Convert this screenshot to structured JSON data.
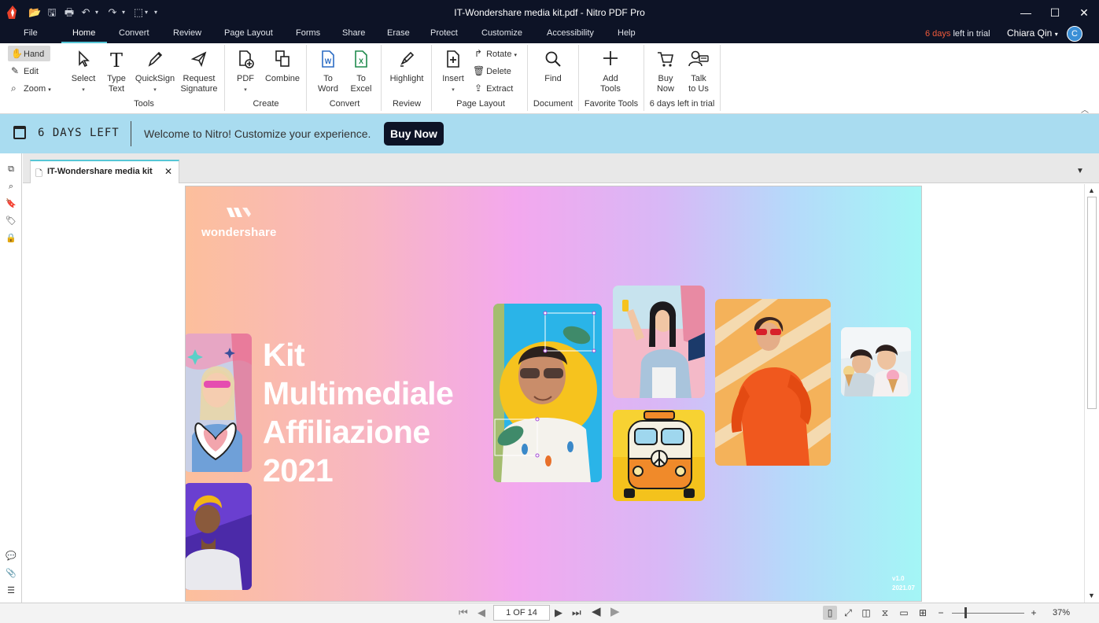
{
  "window": {
    "title": "IT-Wondershare media kit.pdf - Nitro PDF Pro",
    "min_glyph": "—",
    "max_glyph": "☐",
    "close_glyph": "✕"
  },
  "menu": {
    "tabs": [
      "File",
      "Home",
      "Convert",
      "Review",
      "Page Layout",
      "Forms",
      "Share",
      "Erase",
      "Protect",
      "Customize",
      "Accessibility",
      "Help"
    ],
    "active": "Home",
    "trial_days": "6 days",
    "trial_rest": " left in trial",
    "user_name": "Chiara Qin",
    "user_initial": "C"
  },
  "ribbon": {
    "nav_tools": [
      {
        "label": "Hand",
        "icon": "hand-icon"
      },
      {
        "label": "Edit",
        "icon": "edit-icon"
      },
      {
        "label": "Zoom",
        "icon": "zoom-icon"
      }
    ],
    "tools": {
      "select": [
        "Select",
        ""
      ],
      "type_text": [
        "Type",
        "Text"
      ],
      "quicksign": [
        "QuickSign",
        ""
      ],
      "request_signature": [
        "Request",
        "Signature"
      ],
      "group_label": "Tools"
    },
    "create": {
      "pdf": [
        "PDF",
        ""
      ],
      "combine": [
        "Combine",
        ""
      ],
      "group_label": "Create"
    },
    "convert": {
      "to_word": [
        "To",
        "Word"
      ],
      "to_excel": [
        "To",
        "Excel"
      ],
      "group_label": "Convert"
    },
    "review": {
      "highlight": [
        "Highlight",
        ""
      ],
      "group_label": "Review"
    },
    "page_layout": {
      "insert": [
        "Insert",
        ""
      ],
      "rotate": "Rotate",
      "delete": "Delete",
      "extract": "Extract",
      "group_label": "Page Layout"
    },
    "document": {
      "find": [
        "Find",
        ""
      ],
      "group_label": "Document"
    },
    "favorite": {
      "add_tools": [
        "Add",
        "Tools"
      ],
      "group_label": "Favorite Tools"
    },
    "trial_group": {
      "buy_now": [
        "Buy",
        "Now"
      ],
      "talk_to_us": [
        "Talk",
        "to Us"
      ],
      "group_label": "6 days left in trial"
    }
  },
  "banner": {
    "days_left": "6 DAYS LEFT",
    "welcome": "Welcome to Nitro! Customize your experience.",
    "buy_now": "Buy Now",
    "background_color": "#a9dcf0"
  },
  "document_tab": {
    "title": "IT-Wondershare media kit",
    "close_glyph": "✕"
  },
  "pdf_page": {
    "brand": "wondershare",
    "headline": [
      "Kit",
      "Multimediale",
      "Affiliazione",
      "2021"
    ],
    "version": "v1.0",
    "date": "2021.07"
  },
  "status": {
    "page_indicator": "1 OF 14",
    "zoom": "37%"
  },
  "colors": {
    "titlebar": "#0d1326",
    "accent": "#56c6d6",
    "trial_days": "#f05a3b",
    "logo": "#e8402a"
  }
}
